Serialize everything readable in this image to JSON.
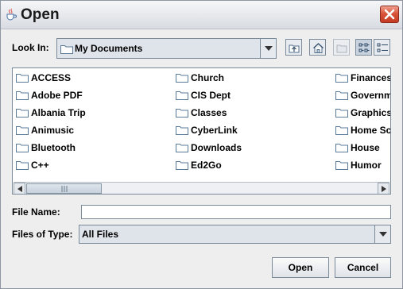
{
  "window": {
    "title": "Open"
  },
  "look_in": {
    "label": "Look In:",
    "value": "My Documents"
  },
  "files": {
    "column1": [
      "ACCESS",
      "Adobe PDF",
      "Albania Trip",
      "Animusic",
      "Bluetooth",
      "C++"
    ],
    "column2": [
      "Church",
      "CIS Dept",
      "Classes",
      "CyberLink",
      "Downloads",
      "Ed2Go"
    ],
    "column3": [
      "Finances",
      "Governm",
      "Graphics",
      "Home Sc",
      "House",
      "Humor"
    ]
  },
  "file_name": {
    "label": "File Name:",
    "value": ""
  },
  "files_of_type": {
    "label": "Files of Type:",
    "value": "All Files"
  },
  "buttons": {
    "open": "Open",
    "cancel": "Cancel"
  }
}
